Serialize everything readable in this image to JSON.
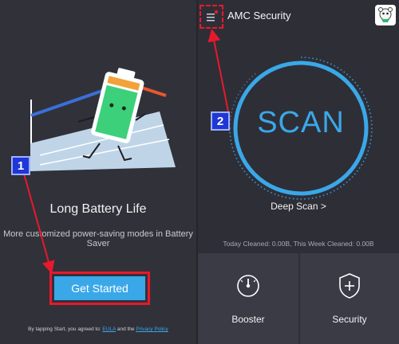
{
  "left": {
    "title": "Long Battery Life",
    "subtitle": "More customized power-saving modes in Battery Saver",
    "cta_label": "Get Started",
    "terms_prefix": "By tapping Start, you agreed to:",
    "terms_eula": "EULA",
    "terms_and": "and the",
    "terms_privacy": "Privacy Policy"
  },
  "right": {
    "app_title": "AMC Security",
    "scan_label": "SCAN",
    "deep_scan_label": "Deep Scan >",
    "cleaned_text": "Today Cleaned: 0.00B, This Week Cleaned: 0.00B",
    "tiles": [
      {
        "label": "Booster",
        "icon": "gauge-icon"
      },
      {
        "label": "Security",
        "icon": "shield-plus-icon"
      }
    ]
  },
  "annotations": {
    "badge_1": "1",
    "badge_2": "2",
    "highlight_color": "#e8192c",
    "badge_color": "#1f37d6"
  },
  "colors": {
    "accent": "#3aa8e8",
    "background": "#31313a",
    "tile": "#3b3b46"
  }
}
